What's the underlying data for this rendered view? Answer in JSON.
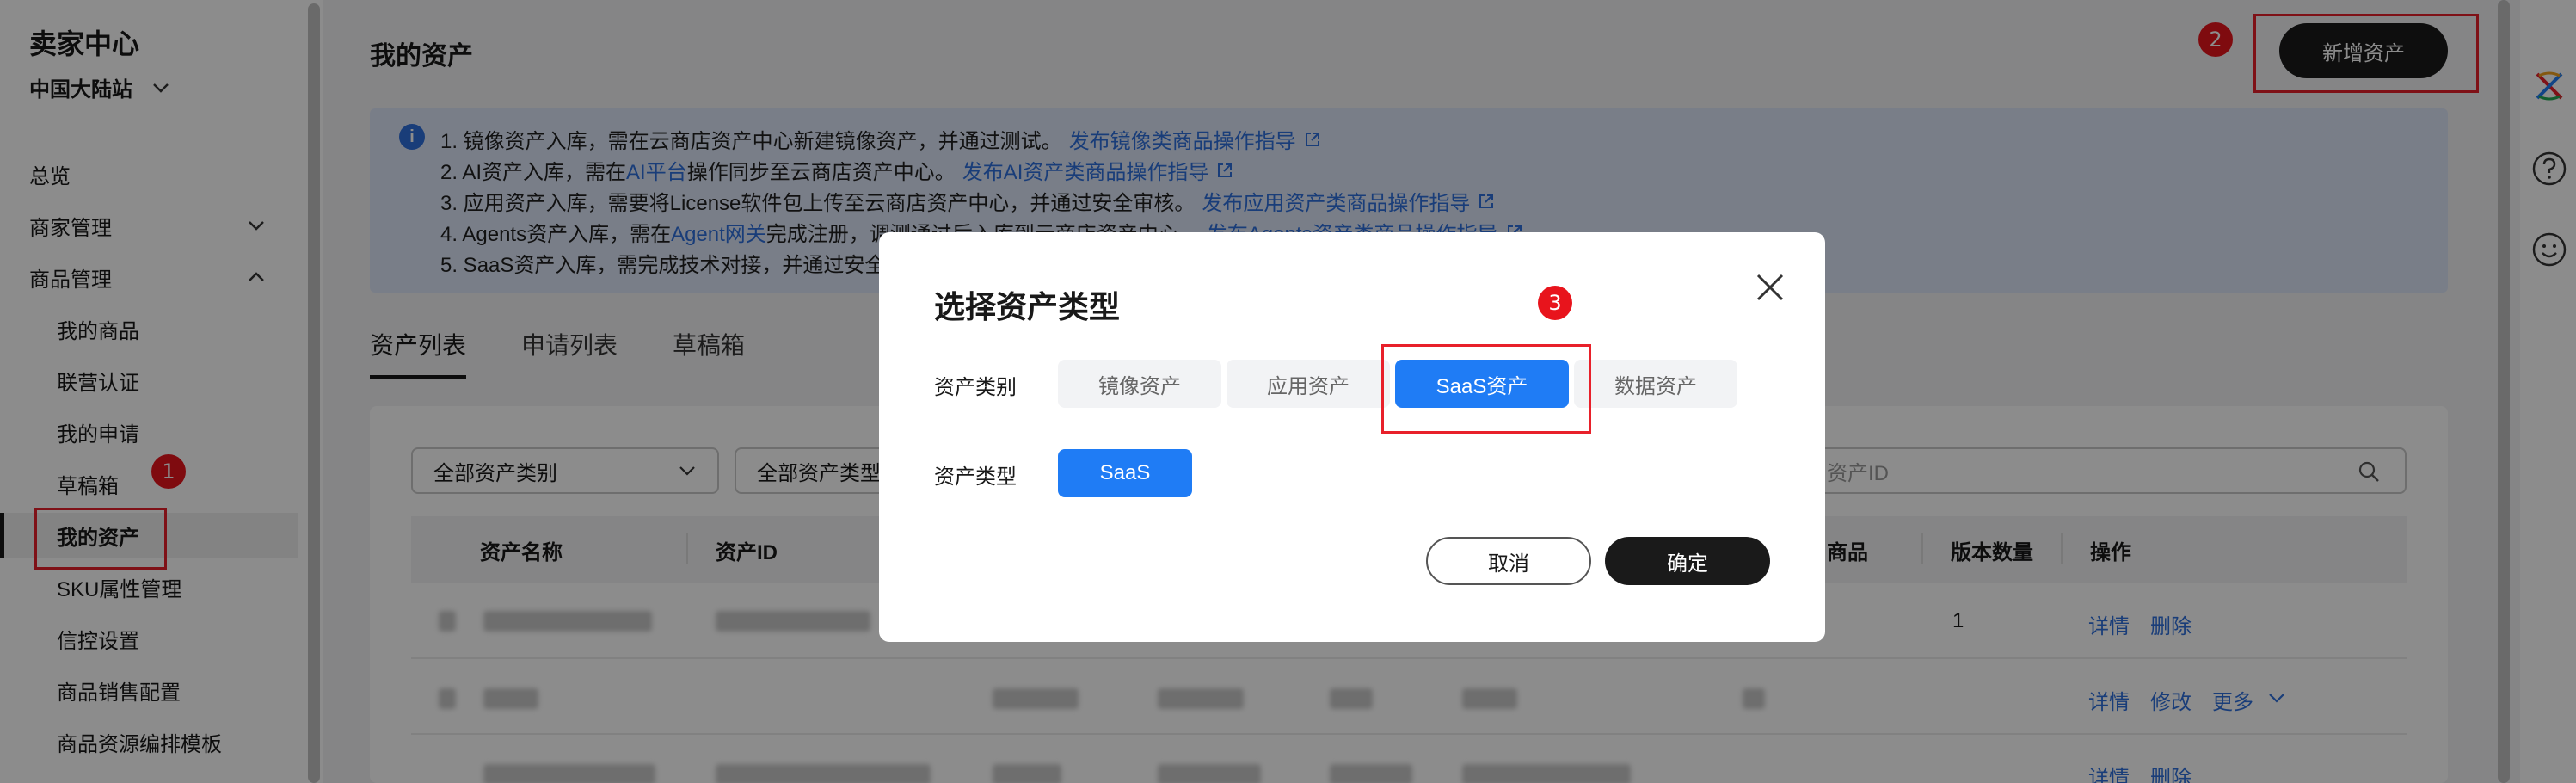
{
  "sidebar": {
    "title": "卖家中心",
    "site": "中国大陆站",
    "items": [
      {
        "label": "总览"
      },
      {
        "label": "商家管理"
      },
      {
        "label": "商品管理"
      },
      {
        "label": "我的商品"
      },
      {
        "label": "联营认证"
      },
      {
        "label": "我的申请"
      },
      {
        "label": "草稿箱"
      },
      {
        "label": "我的资产"
      },
      {
        "label": "SKU属性管理"
      },
      {
        "label": "信控设置"
      },
      {
        "label": "商品销售配置"
      },
      {
        "label": "商品资源编排模板"
      }
    ]
  },
  "header": {
    "title": "我的资产",
    "new_asset_label": "新增资产"
  },
  "info": {
    "icon": "i",
    "lines": [
      {
        "text": "1. 镜像资产入库，需在云商店资产中心新建镜像资产，并通过测试。",
        "link": "发布镜像类商品操作指导"
      },
      {
        "pre": "2. AI资产入库，需在 ",
        "mid_link": "AI平台",
        "post": " 操作同步至云商店资产中心。",
        "link": "发布AI资产类商品操作指导"
      },
      {
        "text": "3. 应用资产入库，需要将License软件包上传至云商店资产中心，并通过安全审核。",
        "link": "发布应用资产类商品操作指导"
      },
      {
        "pre": "4. Agents资产入库，需在",
        "mid_link": "Agent网关",
        "post": "完成注册，调测通过后入库到云商店资产中心。",
        "link": "发布Agents资产类商品操作指导"
      },
      {
        "text": "5. SaaS资产入库，需完成技术对接，并通过安全"
      }
    ]
  },
  "tabs": [
    {
      "label": "资产列表"
    },
    {
      "label": "申请列表"
    },
    {
      "label": "草稿箱"
    }
  ],
  "filters": {
    "category": "全部资产类别",
    "type": "全部资产类型",
    "search_placeholder": "资产ID"
  },
  "table": {
    "columns": [
      "资产名称",
      "资产ID",
      "商品",
      "版本数量",
      "操作"
    ],
    "rows": [
      {
        "version_count": "1",
        "actions": [
          "详情",
          "删除"
        ]
      },
      {
        "version_count": "",
        "actions": [
          "详情",
          "修改",
          "更多"
        ]
      },
      {
        "version_count": "",
        "actions": [
          "详情",
          "删除"
        ]
      }
    ]
  },
  "modal": {
    "title": "选择资产类型",
    "category_label": "资产类别",
    "type_label": "资产类型",
    "category_options": [
      "镜像资产",
      "应用资产",
      "SaaS资产",
      "数据资产"
    ],
    "selected_category": "SaaS资产",
    "type_options": [
      "SaaS"
    ],
    "cancel_label": "取消",
    "ok_label": "确定"
  },
  "annotations": [
    "1",
    "2",
    "3"
  ],
  "colors": {
    "accent": "#1f7cf5",
    "link": "#2e6fdc",
    "highlight": "#e8202a",
    "dark_button": "#1a1a1a"
  }
}
